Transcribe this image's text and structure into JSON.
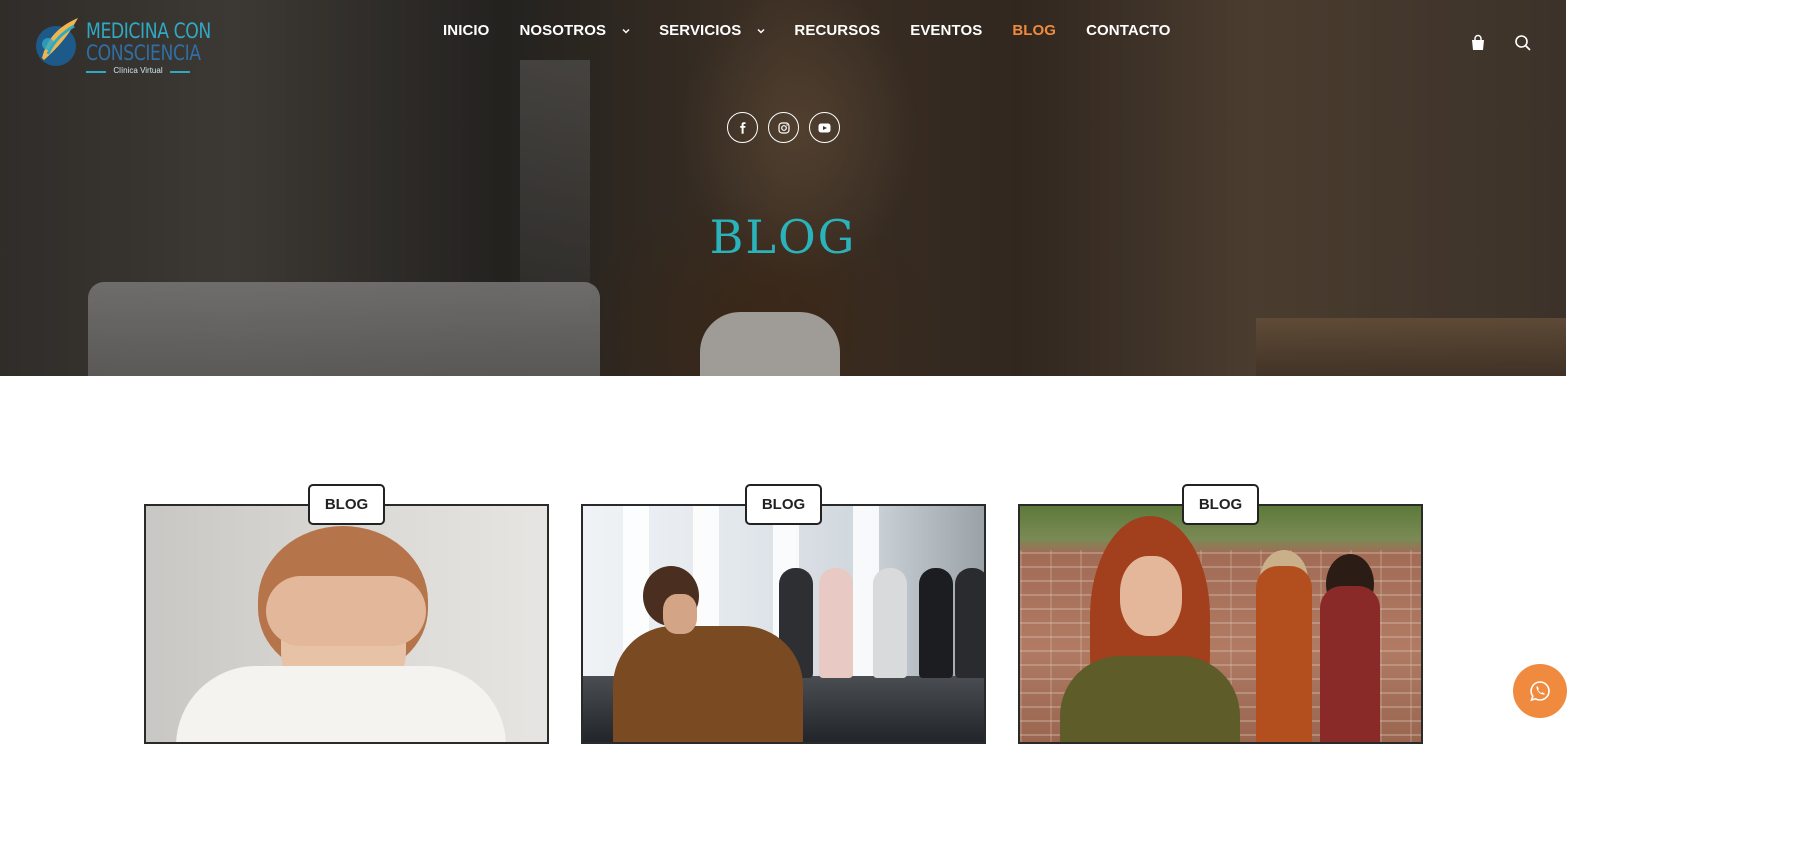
{
  "brand": {
    "line1": "MEDICINA CON",
    "line2": "CONSCIENCIA",
    "tagline": "Clínica Virtual"
  },
  "nav": {
    "items": [
      {
        "label": "INICIO",
        "has_dropdown": false,
        "active": false
      },
      {
        "label": "NOSOTROS",
        "has_dropdown": true,
        "active": false
      },
      {
        "label": "SERVICIOS",
        "has_dropdown": true,
        "active": false
      },
      {
        "label": "RECURSOS",
        "has_dropdown": false,
        "active": false
      },
      {
        "label": "EVENTOS",
        "has_dropdown": false,
        "active": false
      },
      {
        "label": "BLOG",
        "has_dropdown": false,
        "active": true
      },
      {
        "label": "CONTACTO",
        "has_dropdown": false,
        "active": false
      }
    ],
    "icons": [
      "shopping-bag-icon",
      "search-icon"
    ]
  },
  "social": [
    "facebook-icon",
    "instagram-icon",
    "youtube-icon"
  ],
  "hero": {
    "title": "BLOG"
  },
  "posts": [
    {
      "category": "BLOG",
      "image": "child-covering-eyes-photo"
    },
    {
      "category": "BLOG",
      "image": "group-therapy-photo"
    },
    {
      "category": "BLOG",
      "image": "teen-girls-wall-photo"
    }
  ],
  "floating": {
    "icon": "whatsapp-icon"
  },
  "colors": {
    "accent_orange": "#f08a3e",
    "accent_teal": "#2ab3ba",
    "logo_blue": "#2f6fa6",
    "nav_text": "#ffffff"
  }
}
